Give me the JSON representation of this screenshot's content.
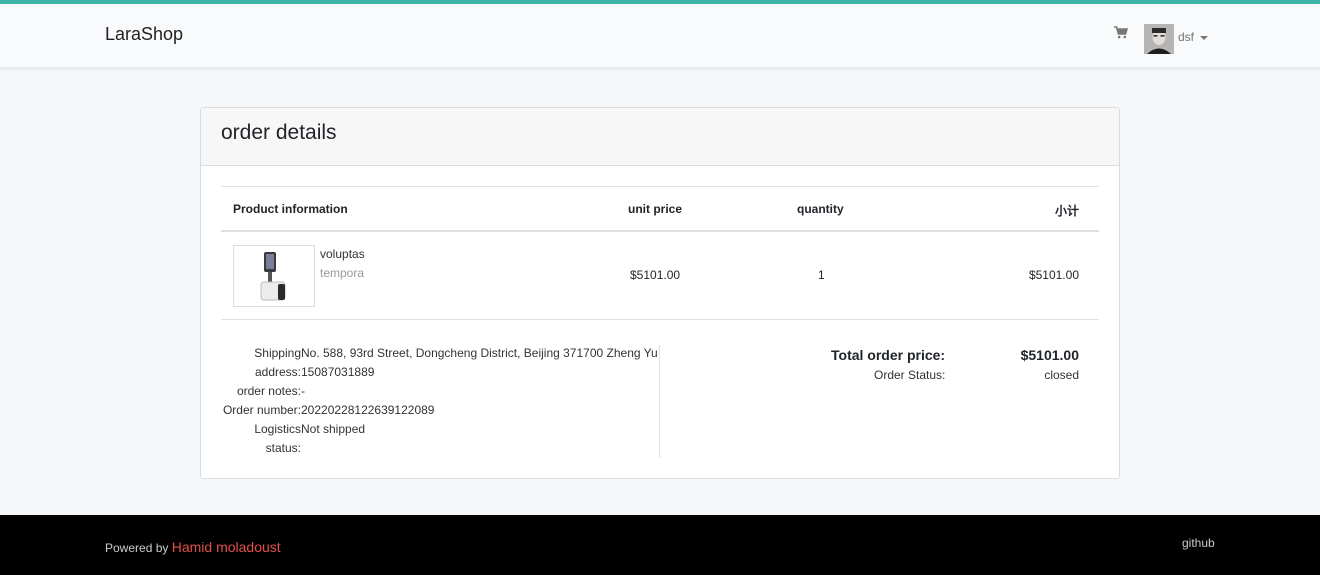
{
  "navbar": {
    "brand": "LaraShop",
    "user_name": "dsf",
    "accent_color": "#3ab5a8"
  },
  "order": {
    "title": "order details",
    "columns": {
      "product": "Product information",
      "unit_price": "unit price",
      "quantity": "quantity",
      "subtotal": "小计"
    },
    "items": [
      {
        "title": "voluptas",
        "sku": "tempora",
        "unit_price": "$5101.00",
        "quantity": "1",
        "subtotal": "$5101.00"
      }
    ],
    "info": {
      "shipping_label_1": "Shipping",
      "shipping_label_2": "address:",
      "shipping_line_1": "No. 588, 93rd Street, Dongcheng District, Beijing 371700 Zheng Yu",
      "shipping_line_2": "15087031889",
      "notes_label": "order notes:",
      "notes_value": "-",
      "number_label": "Order number:",
      "number_value": "20220228122639122089",
      "logistics_label_1": "Logistics",
      "logistics_label_2": "status:",
      "logistics_value": "Not shipped"
    },
    "summary": {
      "total_label": "Total order price:",
      "total_value": "$5101.00",
      "status_label": "Order Status:",
      "status_value": "closed"
    }
  },
  "footer": {
    "powered_by": "Powered by",
    "author": "Hamid moladoust",
    "author_color": "#e3504a",
    "github": "github"
  }
}
